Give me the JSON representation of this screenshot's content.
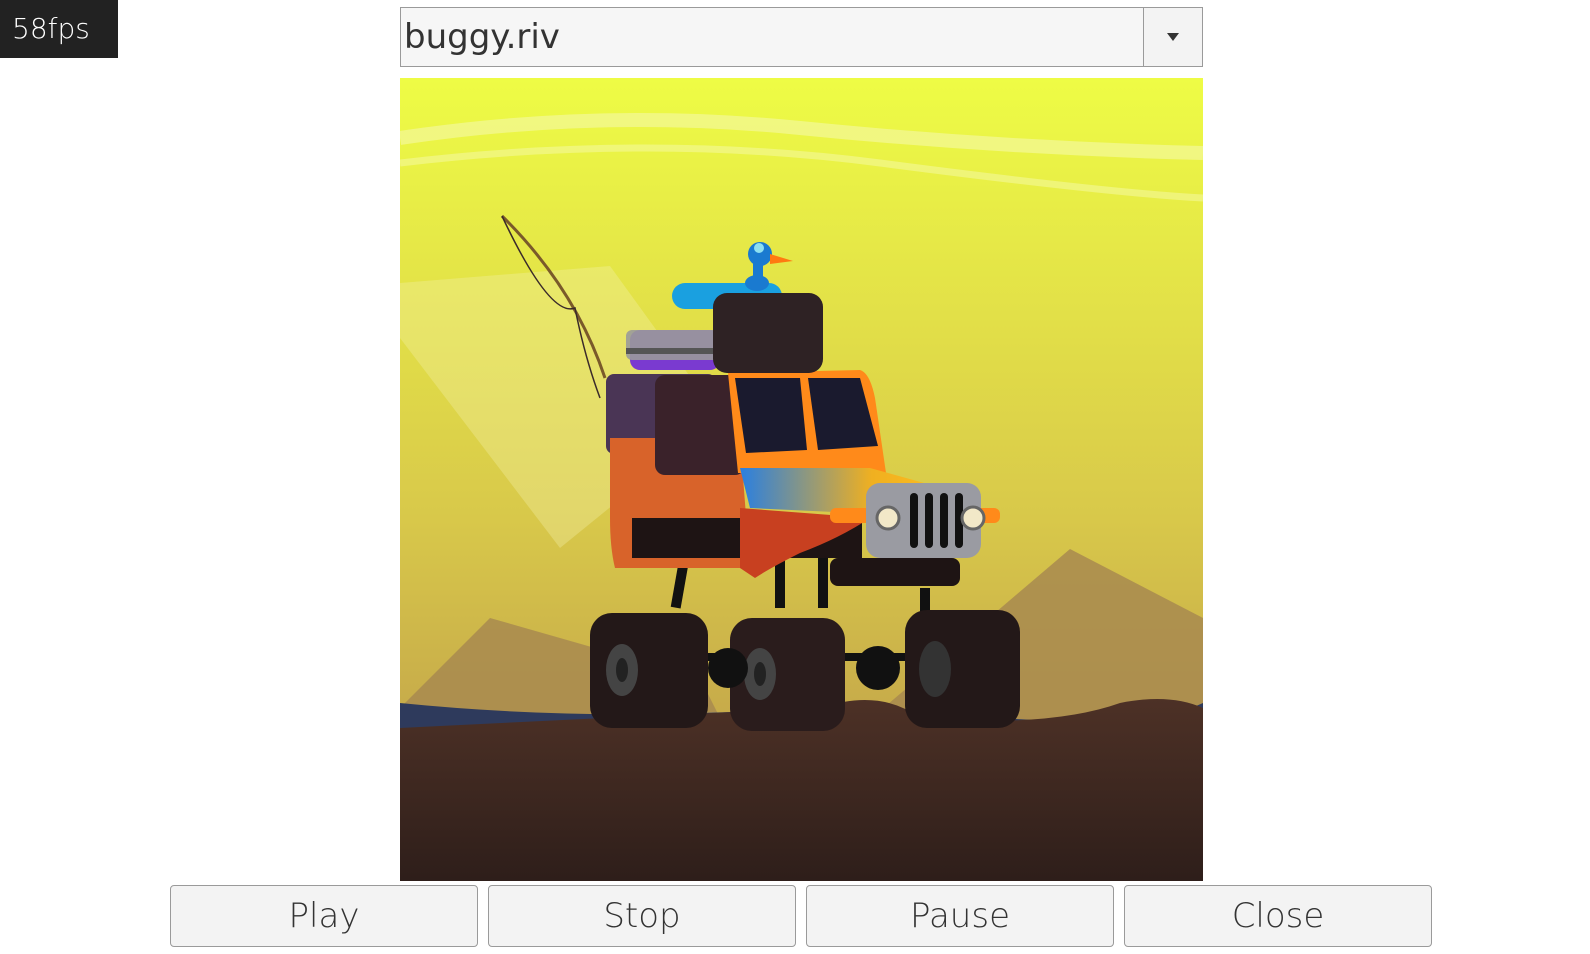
{
  "fps_counter": "58fps",
  "file_select": {
    "selected": "buggy.riv"
  },
  "controls": {
    "play": "Play",
    "stop": "Stop",
    "pause": "Pause",
    "close": "Close"
  },
  "animation": {
    "sky_top": "#eef542",
    "sky_bottom": "#c9a64a",
    "ground": "#4a2e24",
    "vehicle_body": "#e06a2a"
  }
}
